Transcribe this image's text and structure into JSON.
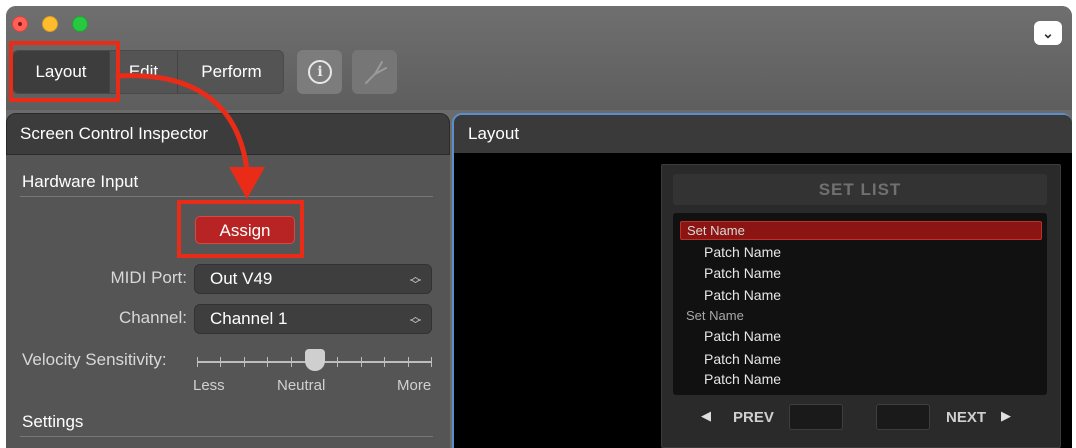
{
  "window": {
    "menu_icon": "chevron-down-icon",
    "menu_glyph": "⌄"
  },
  "toolbar": {
    "segments": [
      {
        "label": "Layout",
        "selected": true
      },
      {
        "label": "Edit",
        "selected": false
      },
      {
        "label": "Perform",
        "selected": false
      }
    ],
    "info_icon": "info-icon",
    "info_glyph": "i",
    "tuner_icon": "tuning-fork-icon"
  },
  "inspector": {
    "title": "Screen Control Inspector",
    "hardware_input": {
      "title": "Hardware Input",
      "assign_label": "Assign",
      "midi_port": {
        "label": "MIDI Port:",
        "value": "Out V49"
      },
      "channel": {
        "label": "Channel:",
        "value": "Channel 1"
      },
      "velocity": {
        "label": "Velocity Sensitivity:",
        "min_label": "Less",
        "mid_label": "Neutral",
        "max_label": "More",
        "level": 0.5
      }
    },
    "settings_title": "Settings"
  },
  "layout_panel": {
    "title": "Layout",
    "setlist": {
      "header": "SET LIST",
      "rows": [
        {
          "kind": "set",
          "label": "Set Name",
          "selected": true
        },
        {
          "kind": "patch",
          "label": "Patch Name"
        },
        {
          "kind": "patch",
          "label": "Patch Name"
        },
        {
          "kind": "patch",
          "label": "Patch Name"
        },
        {
          "kind": "set",
          "label": "Set Name",
          "selected": false
        },
        {
          "kind": "patch",
          "label": "Patch Name"
        },
        {
          "kind": "patch",
          "label": "Patch Name"
        },
        {
          "kind": "patch",
          "label": "Patch Name"
        }
      ],
      "prev_label": "PREV",
      "next_label": "NEXT"
    }
  },
  "colors": {
    "annotation": "#ea2b18",
    "assign_button": "#b72423",
    "selected_set": "#8a1512",
    "layout_focus_border": "#5a8fcf"
  }
}
